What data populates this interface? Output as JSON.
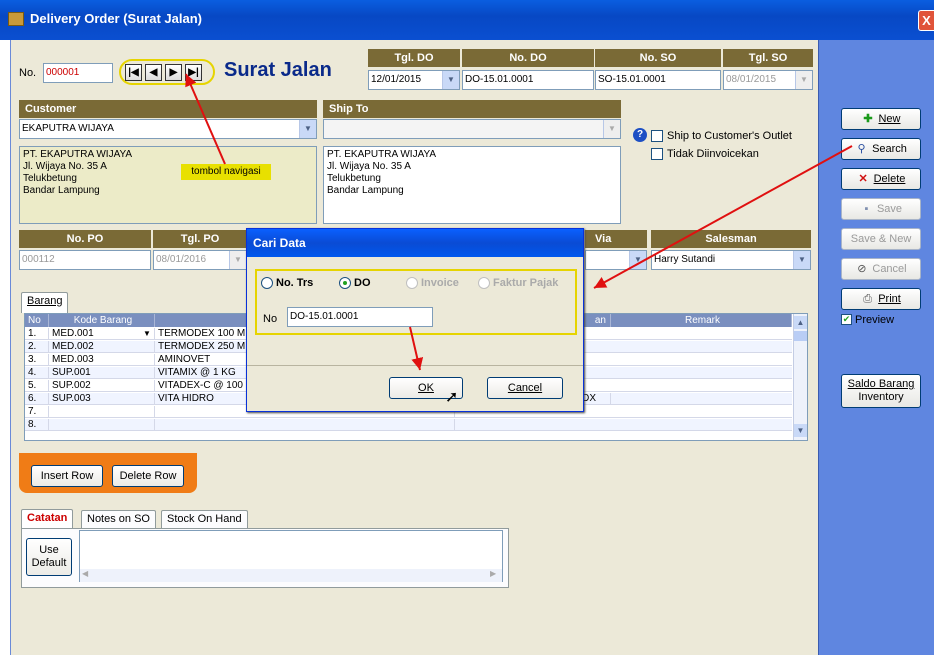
{
  "window": {
    "title": "Delivery Order (Surat Jalan)",
    "close_glyph": "X"
  },
  "header": {
    "no_label": "No.",
    "no_value": "000001",
    "nav_buttons": [
      "|◀",
      "◀",
      "▶",
      "▶|"
    ],
    "form_title": "Surat Jalan",
    "tgl_do_label": "Tgl. DO",
    "tgl_do_value": "12/01/2015",
    "no_do_label": "No. DO",
    "no_do_value": "DO-15.01.0001",
    "no_so_label": "No. SO",
    "no_so_value": "SO-15.01.0001",
    "tgl_so_label": "Tgl. SO",
    "tgl_so_value": "08/01/2015"
  },
  "customer": {
    "label": "Customer",
    "selected": "EKAPUTRA WIJAYA",
    "address": [
      "PT. EKAPUTRA WIJAYA",
      "Jl. Wijaya No. 35 A",
      "Telukbetung",
      "Bandar Lampung"
    ]
  },
  "ship_to": {
    "label": "Ship To",
    "selected": "",
    "address": [
      "PT. EKAPUTRA WIJAYA",
      "Jl. Wijaya No. 35 A",
      "Telukbetung",
      "Bandar Lampung"
    ]
  },
  "options": {
    "ship_outlet": "Ship to Customer's Outlet",
    "tidak_diinvoicekan": "Tidak Diinvoicekan"
  },
  "annotation": {
    "text": "tombol navigasi",
    "color": "#e8e000"
  },
  "po": {
    "no_po_label": "No. PO",
    "no_po_value": "000112",
    "tgl_po_label": "Tgl. PO",
    "tgl_po_value": "08/01/2016",
    "via_label": "Via",
    "via_value": "",
    "salesman_label": "Salesman",
    "salesman_value": "Harry Sutandi"
  },
  "grid": {
    "tab_label": "Barang",
    "columns": [
      "No",
      "Kode Barang",
      "",
      "",
      "an",
      "Remark"
    ],
    "rows": [
      {
        "no": "1.",
        "kode": "MED.001",
        "nama": "TERMODEX 100 M",
        "qty": ""
      },
      {
        "no": "2.",
        "kode": "MED.002",
        "nama": "TERMODEX 250 M",
        "qty": ""
      },
      {
        "no": "3.",
        "kode": "MED.003",
        "nama": "AMINOVET",
        "qty": ""
      },
      {
        "no": "4.",
        "kode": "SUP.001",
        "nama": "VITAMIX @ 1 KG",
        "qty": ""
      },
      {
        "no": "5.",
        "kode": "SUP.002",
        "nama": "VITADEX-C @ 100",
        "qty": ""
      },
      {
        "no": "6.",
        "kode": "SUP.003",
        "nama": "VITA HIDRO",
        "qty": "10 BOX"
      },
      {
        "no": "7.",
        "kode": "",
        "nama": "",
        "qty": ""
      },
      {
        "no": "8.",
        "kode": "",
        "nama": "",
        "qty": ""
      }
    ]
  },
  "row_buttons": {
    "insert": "Insert Row",
    "delete": "Delete Row"
  },
  "notes_tabs": [
    "Catatan",
    "Notes on SO",
    "Stock On Hand"
  ],
  "use_default": [
    "Use",
    "Default"
  ],
  "sidebar": {
    "new": "New",
    "search": "Search",
    "delete": "Delete",
    "save": "Save",
    "save_new": "Save & New",
    "cancel": "Cancel",
    "print": "Print",
    "preview": "Preview",
    "saldo": [
      "Saldo Barang",
      "Inventory"
    ]
  },
  "dialog": {
    "title": "Cari Data",
    "radio_no_trs": "No. Trs",
    "radio_do": "DO",
    "radio_invoice": "Invoice",
    "radio_faktur": "Faktur Pajak",
    "no_label": "No",
    "no_value": "DO-15.01.0001",
    "ok": "OK",
    "cancel": "Cancel"
  },
  "colors": {
    "arrow": "#e01010",
    "highlight": "#e6d400",
    "header_bar": "#7a6a36",
    "sidebar": "#5f86e0"
  }
}
